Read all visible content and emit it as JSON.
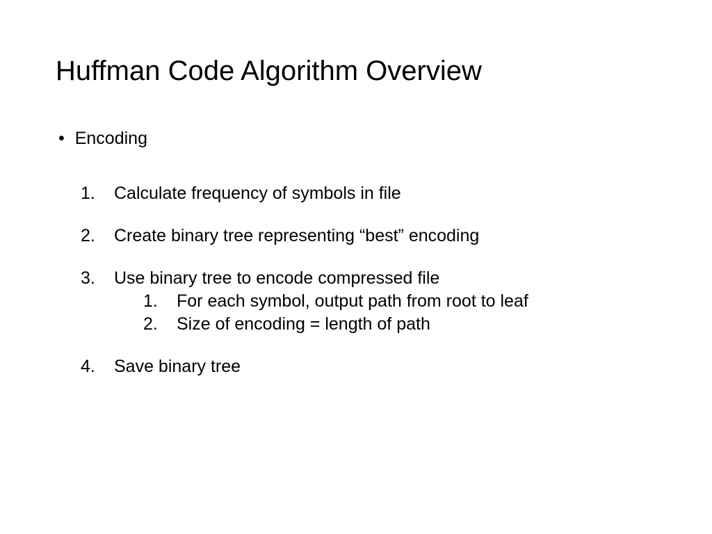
{
  "title": "Huffman Code Algorithm Overview",
  "bullet": {
    "label": "Encoding"
  },
  "steps": [
    {
      "num": "1.",
      "text": "Calculate frequency of symbols in file"
    },
    {
      "num": "2.",
      "text": "Create binary tree representing “best” encoding"
    },
    {
      "num": "3.",
      "text": "Use binary tree to encode compressed file"
    },
    {
      "num": "4.",
      "text": "Save binary tree"
    }
  ],
  "substeps": [
    {
      "num": "1.",
      "text": "For each symbol, output path from root to leaf"
    },
    {
      "num": "2.",
      "text": "Size of encoding = length of path"
    }
  ]
}
